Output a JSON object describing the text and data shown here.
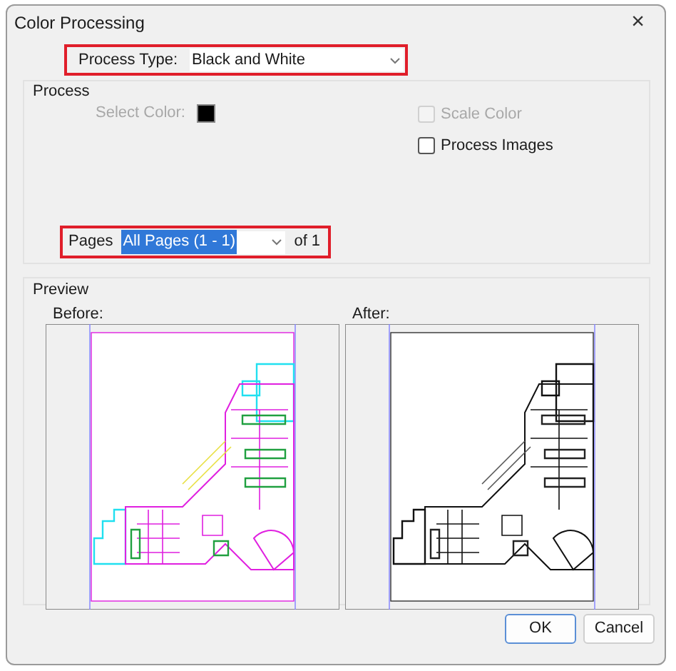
{
  "window": {
    "title": "Color Processing",
    "close": "×"
  },
  "process_type": {
    "label": "Process Type:",
    "value": "Black and White",
    "highlighted": true
  },
  "process": {
    "title": "Process",
    "select_color": {
      "label": "Select Color:",
      "disabled": true,
      "color": "#000000"
    },
    "checkboxes": [
      {
        "label": "Scale Color",
        "checked": false,
        "disabled": true
      },
      {
        "label": "Process Images",
        "checked": false,
        "disabled": false
      }
    ]
  },
  "pages": {
    "label": "Pages",
    "value": "All Pages (1 - 1)",
    "value_selected": true,
    "suffix": "of 1",
    "highlighted": true
  },
  "preview": {
    "title": "Preview",
    "panes": [
      {
        "label": "Before:",
        "kind": "color"
      },
      {
        "label": "After:",
        "kind": "mono"
      }
    ]
  },
  "buttons": [
    {
      "label": "OK",
      "default": true
    },
    {
      "label": "Cancel",
      "default": false
    }
  ]
}
